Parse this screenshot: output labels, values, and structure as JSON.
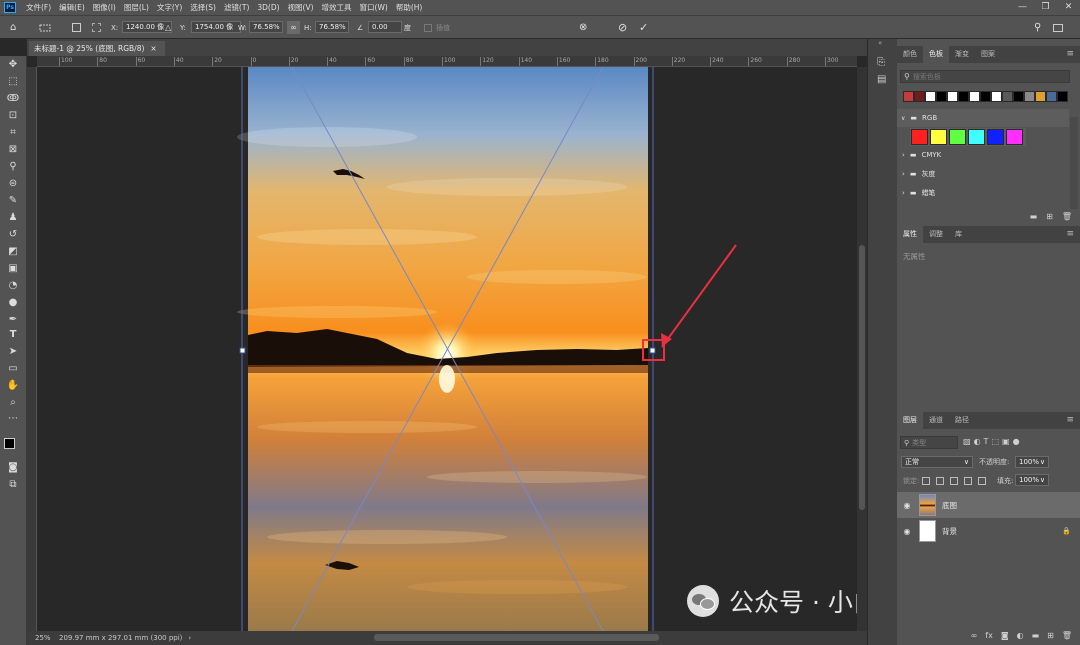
{
  "app": {
    "logo": "Ps"
  },
  "menu": [
    "文件(F)",
    "编辑(E)",
    "图像(I)",
    "图层(L)",
    "文字(Y)",
    "选择(S)",
    "滤镜(T)",
    "3D(D)",
    "视图(V)",
    "增效工具",
    "窗口(W)",
    "帮助(H)"
  ],
  "window_controls": {
    "minimize": "—",
    "restore": "❐",
    "close": "✕"
  },
  "options": {
    "x_label": "X:",
    "x_value": "1240.00 像",
    "y_label": "Y:",
    "y_value": "1754.00 像",
    "w_label": "W:",
    "w_value": "76.58%",
    "h_label": "H:",
    "h_value": "76.58%",
    "angle_value": "0.00",
    "angle_unit": "度",
    "interp_label": "插值",
    "cancel": "⊘",
    "commit": "✓"
  },
  "document": {
    "tab_title": "未标题-1 @ 25% (底图, RGB/8)",
    "tab_close": "×"
  },
  "ruler_top": [
    "100",
    "80",
    "60",
    "40",
    "20",
    "0",
    "20",
    "40",
    "60",
    "80",
    "100",
    "120",
    "140",
    "160",
    "180",
    "200",
    "220",
    "240",
    "260",
    "280",
    "300"
  ],
  "status": {
    "zoom": "25%",
    "doc_info": "209.97 mm x 297.01 mm (300 ppi)",
    "arrow": "›"
  },
  "swatches_panel": {
    "tabs": [
      "颜色",
      "色板",
      "渐变",
      "图案"
    ],
    "active_tab": "色板",
    "search_placeholder": "搜索色板",
    "recent_colors": [
      "#c43c3c",
      "#6e1e1e",
      "#ffffff",
      "#000000",
      "#ffffff",
      "#000000",
      "#ffffff",
      "#000000",
      "#ffffff",
      "#5a5a5a",
      "#000000",
      "#8a8a8a",
      "#e0a030",
      "#4a6a9a",
      "#000000"
    ],
    "groups": [
      {
        "name": "RGB",
        "expanded": true,
        "colors": [
          "#ff2020",
          "#ffff40",
          "#60ff40",
          "#40ffff",
          "#1020ff",
          "#ff30ff"
        ]
      },
      {
        "name": "CMYK",
        "expanded": false
      },
      {
        "name": "灰度",
        "expanded": false
      },
      {
        "name": "蜡笔",
        "expanded": false
      }
    ]
  },
  "properties_panel": {
    "tabs": [
      "属性",
      "调整",
      "库"
    ],
    "active_tab": "属性",
    "empty_text": "无属性"
  },
  "layers_panel": {
    "tabs": [
      "图层",
      "通道",
      "路径"
    ],
    "active_tab": "图层",
    "search_placeholder": "类型",
    "blend_mode": "正常",
    "opacity_label": "不透明度:",
    "opacity_value": "100%",
    "lock_label": "锁定:",
    "fill_label": "填充:",
    "fill_value": "100%",
    "layers": [
      {
        "name": "底图",
        "visible": true,
        "selected": true
      },
      {
        "name": "背景",
        "visible": true,
        "selected": false,
        "locked": true
      }
    ]
  },
  "watermark": {
    "text": "公众号 · 小白电脑技术"
  }
}
